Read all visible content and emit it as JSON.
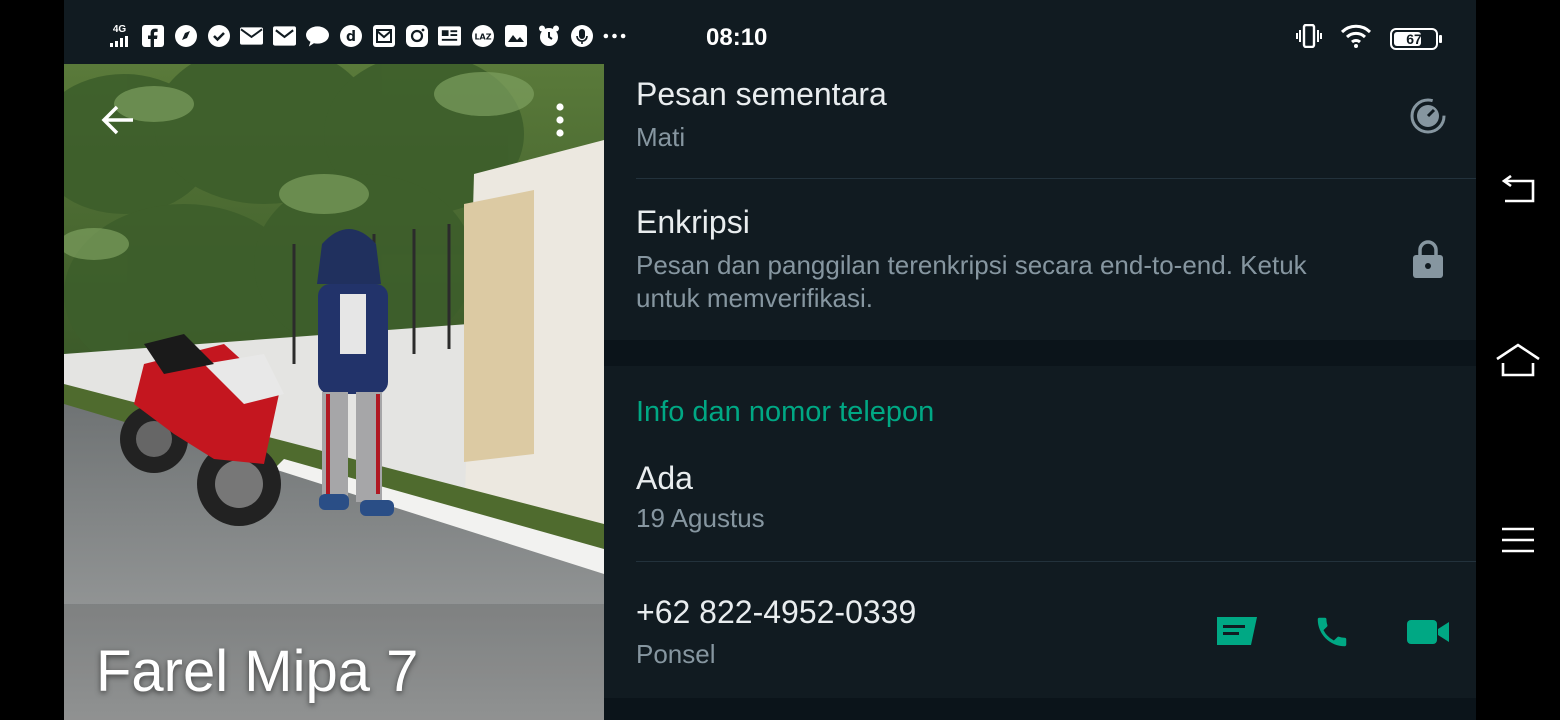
{
  "status_bar": {
    "time": "08:10",
    "network": "4G",
    "battery_percent": "67",
    "battery_level": 0.67,
    "left_icons": [
      "facebook-icon",
      "compass-icon",
      "check-circle-icon",
      "mail-icon",
      "gmail-icon",
      "chat-bubble-icon",
      "dana-icon",
      "mail-box-icon",
      "instagram-icon",
      "news-icon",
      "lazada-icon",
      "photo-icon",
      "alarm-icon",
      "microphone-icon",
      "more-dots-icon"
    ],
    "right_icons": [
      "vibrate-icon",
      "wifi-icon",
      "battery-icon"
    ]
  },
  "profile": {
    "name": "Farel Mipa 7"
  },
  "details": {
    "disappearing": {
      "title": "Pesan sementara",
      "value": "Mati",
      "icon": "timer-icon"
    },
    "encryption": {
      "title": "Enkripsi",
      "description": "Pesan dan panggilan terenkripsi secara end-to-end. Ketuk untuk memverifikasi.",
      "icon": "lock-icon"
    },
    "info_section": {
      "header": "Info dan nomor telepon",
      "about": "Ada",
      "about_date": "19 Agustus",
      "phone": "+62 822-4952-0339",
      "phone_type": "Ponsel"
    }
  },
  "colors": {
    "background": "#111b21",
    "band": "#0b141a",
    "accent": "#00a884",
    "secondary_text": "#8696a0",
    "primary_text": "#e9edef"
  },
  "nav": [
    "back-icon",
    "home-icon",
    "recents-menu-icon"
  ]
}
